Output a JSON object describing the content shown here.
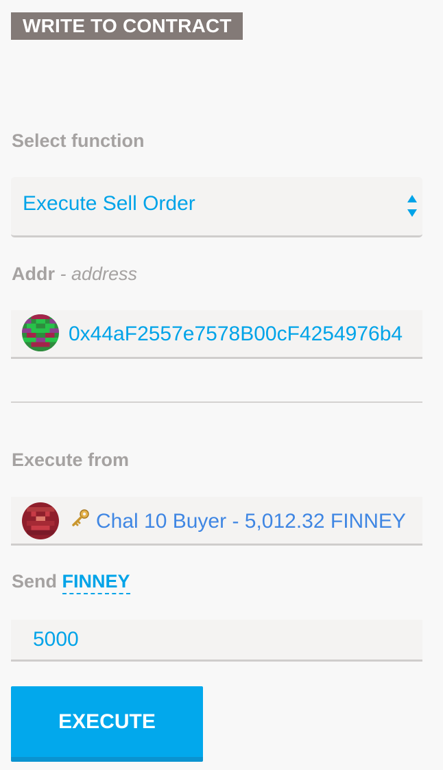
{
  "section": {
    "title": "WRITE TO CONTRACT"
  },
  "select_function": {
    "label": "Select function",
    "selected": "Execute Sell Order"
  },
  "addr": {
    "label": "Addr",
    "separator": " - ",
    "type_hint": "address",
    "value": "0x44aF2557e7578B00cF4254976b4"
  },
  "execute_from": {
    "label": "Execute from",
    "account": "Chal 10 Buyer - 5,012.32 FINNEY"
  },
  "send": {
    "label": "Send",
    "unit": "FINNEY",
    "value": "5000"
  },
  "execute_button": {
    "label": "EXECUTE"
  },
  "colors": {
    "accent": "#00a3e8",
    "button": "#02a8ec",
    "title_bg": "#837a77",
    "label": "#a5a2a1",
    "account_text": "#3f86e3"
  },
  "icons": {
    "select_arrows": "up-down-arrows-icon",
    "key": "key-icon"
  }
}
